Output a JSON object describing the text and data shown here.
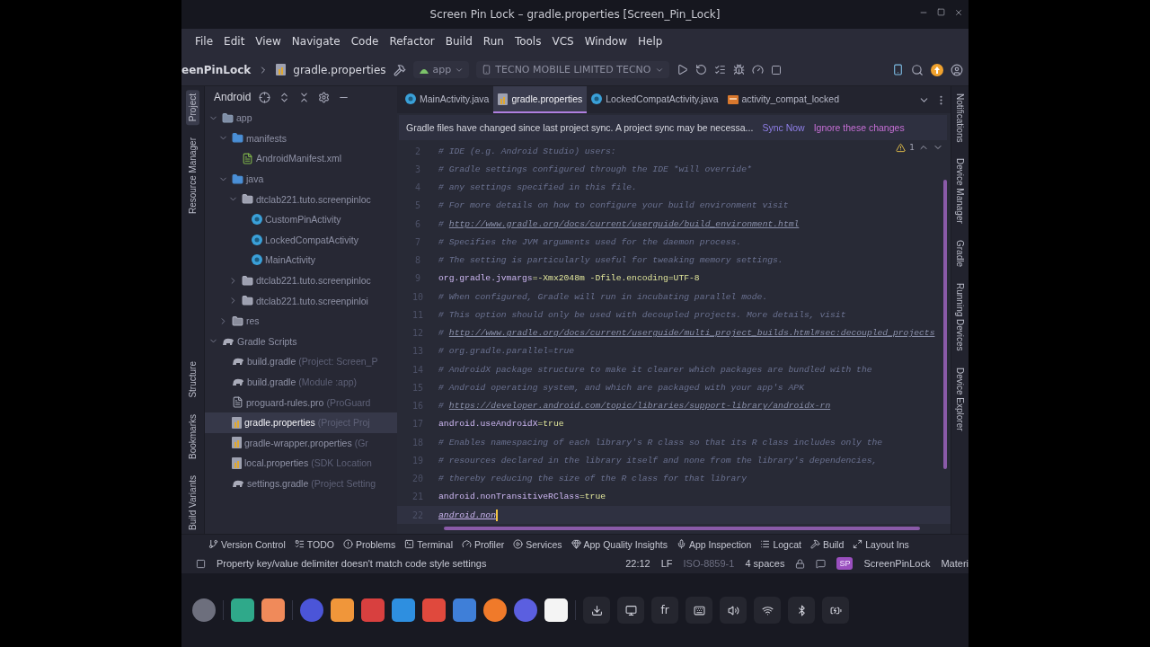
{
  "window": {
    "title": "Screen Pin Lock – gradle.properties [Screen_Pin_Lock]"
  },
  "menu": [
    "File",
    "Edit",
    "View",
    "Navigate",
    "Code",
    "Refactor",
    "Build",
    "Run",
    "Tools",
    "VCS",
    "Window",
    "Help"
  ],
  "nav": {
    "breadcrumb": [
      "eenPinLock",
      "gradle.properties"
    ],
    "run_config": "app",
    "device": "TECNO MOBILE LIMITED TECNO"
  },
  "left_stripe": [
    {
      "label": "Project",
      "selected": true
    },
    {
      "label": "Resource Manager",
      "selected": false
    },
    {
      "label": "Structure",
      "selected": false
    },
    {
      "label": "Bookmarks",
      "selected": false
    },
    {
      "label": "Build Variants",
      "selected": false
    }
  ],
  "right_stripe": [
    "Notifications",
    "Device Manager",
    "Gradle",
    "Running Devices",
    "Device Explorer"
  ],
  "project": {
    "view": "Android",
    "tree": [
      {
        "name": "app",
        "kind": "module",
        "expanded": true,
        "selected": false,
        "children": [
          {
            "name": "manifests",
            "kind": "folder",
            "expanded": true,
            "selected": false,
            "children": [
              {
                "name": "AndroidManifest.xml",
                "kind": "manifest",
                "selected": false
              }
            ]
          },
          {
            "name": "java",
            "kind": "folder",
            "expanded": true,
            "selected": false,
            "children": [
              {
                "name": "dtclab221.tuto.screenpinloc",
                "kind": "package",
                "expanded": true,
                "selected": false,
                "children": [
                  {
                    "name": "CustomPinActivity",
                    "kind": "class",
                    "selected": false
                  },
                  {
                    "name": "LockedCompatActivity",
                    "kind": "class",
                    "selected": false
                  },
                  {
                    "name": "MainActivity",
                    "kind": "class",
                    "selected": false
                  }
                ]
              },
              {
                "name": "dtclab221.tuto.screenpinloc",
                "kind": "package",
                "expanded": false,
                "selected": false
              },
              {
                "name": "dtclab221.tuto.screenpinloi",
                "kind": "package",
                "expanded": false,
                "selected": false
              }
            ]
          },
          {
            "name": "res",
            "kind": "res",
            "expanded": false,
            "selected": false
          }
        ]
      },
      {
        "name": "Gradle Scripts",
        "kind": "gradle",
        "expanded": true,
        "selected": false,
        "children": [
          {
            "name": "build.gradle",
            "detail": "(Project: Screen_P",
            "kind": "gradle",
            "selected": false
          },
          {
            "name": "build.gradle",
            "detail": "(Module :app)",
            "kind": "gradle",
            "selected": false
          },
          {
            "name": "proguard-rules.pro",
            "detail": "(ProGuard",
            "kind": "file",
            "selected": false
          },
          {
            "name": "gradle.properties",
            "detail": "(Project Proj",
            "kind": "properties",
            "selected": true
          },
          {
            "name": "gradle-wrapper.properties",
            "detail": "(Gr",
            "kind": "properties",
            "selected": false
          },
          {
            "name": "local.properties",
            "detail": "(SDK Location",
            "kind": "properties",
            "selected": false
          },
          {
            "name": "settings.gradle",
            "detail": "(Project Setting",
            "kind": "gradle",
            "selected": false
          }
        ]
      }
    ]
  },
  "tabs": [
    {
      "label": "MainActivity.java",
      "kind": "class",
      "selected": false
    },
    {
      "label": "gradle.properties",
      "kind": "properties",
      "selected": true
    },
    {
      "label": "LockedCompatActivity.java",
      "kind": "class",
      "selected": false
    },
    {
      "label": "activity_compat_locked",
      "kind": "layout",
      "selected": false
    }
  ],
  "banner": {
    "message": "Gradle files have changed since last project sync. A project sync may be necessa...",
    "actions": [
      "Sync Now",
      "Ignore these changes"
    ]
  },
  "editor": {
    "warnings": "1",
    "lines": [
      {
        "number": "2",
        "kind": "comment",
        "text": "# IDE (e.g. Android Studio) users:"
      },
      {
        "number": "3",
        "kind": "comment",
        "text": "# Gradle settings configured through the IDE *will override*"
      },
      {
        "number": "4",
        "kind": "comment",
        "text": "# any settings specified in this file."
      },
      {
        "number": "5",
        "kind": "comment",
        "text": "# For more details on how to configure your build environment visit"
      },
      {
        "number": "6",
        "kind": "link",
        "text": "#",
        "link": "http://www.gradle.org/docs/current/userguide/build_environment.html"
      },
      {
        "number": "7",
        "kind": "comment",
        "text": "# Specifies the JVM arguments used for the daemon process."
      },
      {
        "number": "8",
        "kind": "comment",
        "text": "# The setting is particularly useful for tweaking memory settings."
      },
      {
        "number": "9",
        "kind": "property",
        "key": "org.gradle.jvmargs",
        "value": "=-Xmx2048m -Dfile.encoding=UTF-8"
      },
      {
        "number": "10",
        "kind": "comment",
        "text": "# When configured, Gradle will run in incubating parallel mode."
      },
      {
        "number": "11",
        "kind": "comment",
        "text": "# This option should only be used with decoupled projects. More details, visit"
      },
      {
        "number": "12",
        "kind": "link",
        "text": "#",
        "link": "http://www.gradle.org/docs/current/userguide/multi_project_builds.html#sec:decoupled_projects"
      },
      {
        "number": "13",
        "kind": "comment",
        "text": "# org.gradle.parallel=true"
      },
      {
        "number": "14",
        "kind": "comment",
        "text": "# AndroidX package structure to make it clearer which packages are bundled with the"
      },
      {
        "number": "15",
        "kind": "comment",
        "text": "# Android operating system, and which are packaged with your app's APK"
      },
      {
        "number": "16",
        "kind": "link",
        "text": "#",
        "link": "https://developer.android.com/topic/libraries/support-library/androidx-rn"
      },
      {
        "number": "17",
        "kind": "property",
        "key": "android.useAndroidX",
        "value": "=true"
      },
      {
        "number": "18",
        "kind": "comment",
        "text": "# Enables namespacing of each library's R class so that its R class includes only the"
      },
      {
        "number": "19",
        "kind": "comment",
        "text": "# resources declared in the library itself and none from the library's dependencies,"
      },
      {
        "number": "20",
        "kind": "comment",
        "text": "# thereby reducing the size of the R class for that library"
      },
      {
        "number": "21",
        "kind": "property",
        "key": "android.nonTransitiveRClass",
        "value": "=true"
      },
      {
        "number": "22",
        "kind": "typing",
        "key": "android.non",
        "selected": true
      }
    ]
  },
  "tool_windows": [
    "Version Control",
    "TODO",
    "Problems",
    "Terminal",
    "Profiler",
    "Services",
    "App Quality Insights",
    "App Inspection",
    "Logcat",
    "Build",
    "Layout Ins"
  ],
  "status": {
    "message": "Property key/value delimiter doesn't match code style settings",
    "position": "22:12",
    "line_ending": "LF",
    "encoding": {
      "text": "ISO-8859-1",
      "disabled": true
    },
    "indent": "4 spaces",
    "project_badge": "SP",
    "project": "ScreenPinLock",
    "theme": "Materi"
  },
  "taskbar": {
    "keyboard": "fr"
  }
}
